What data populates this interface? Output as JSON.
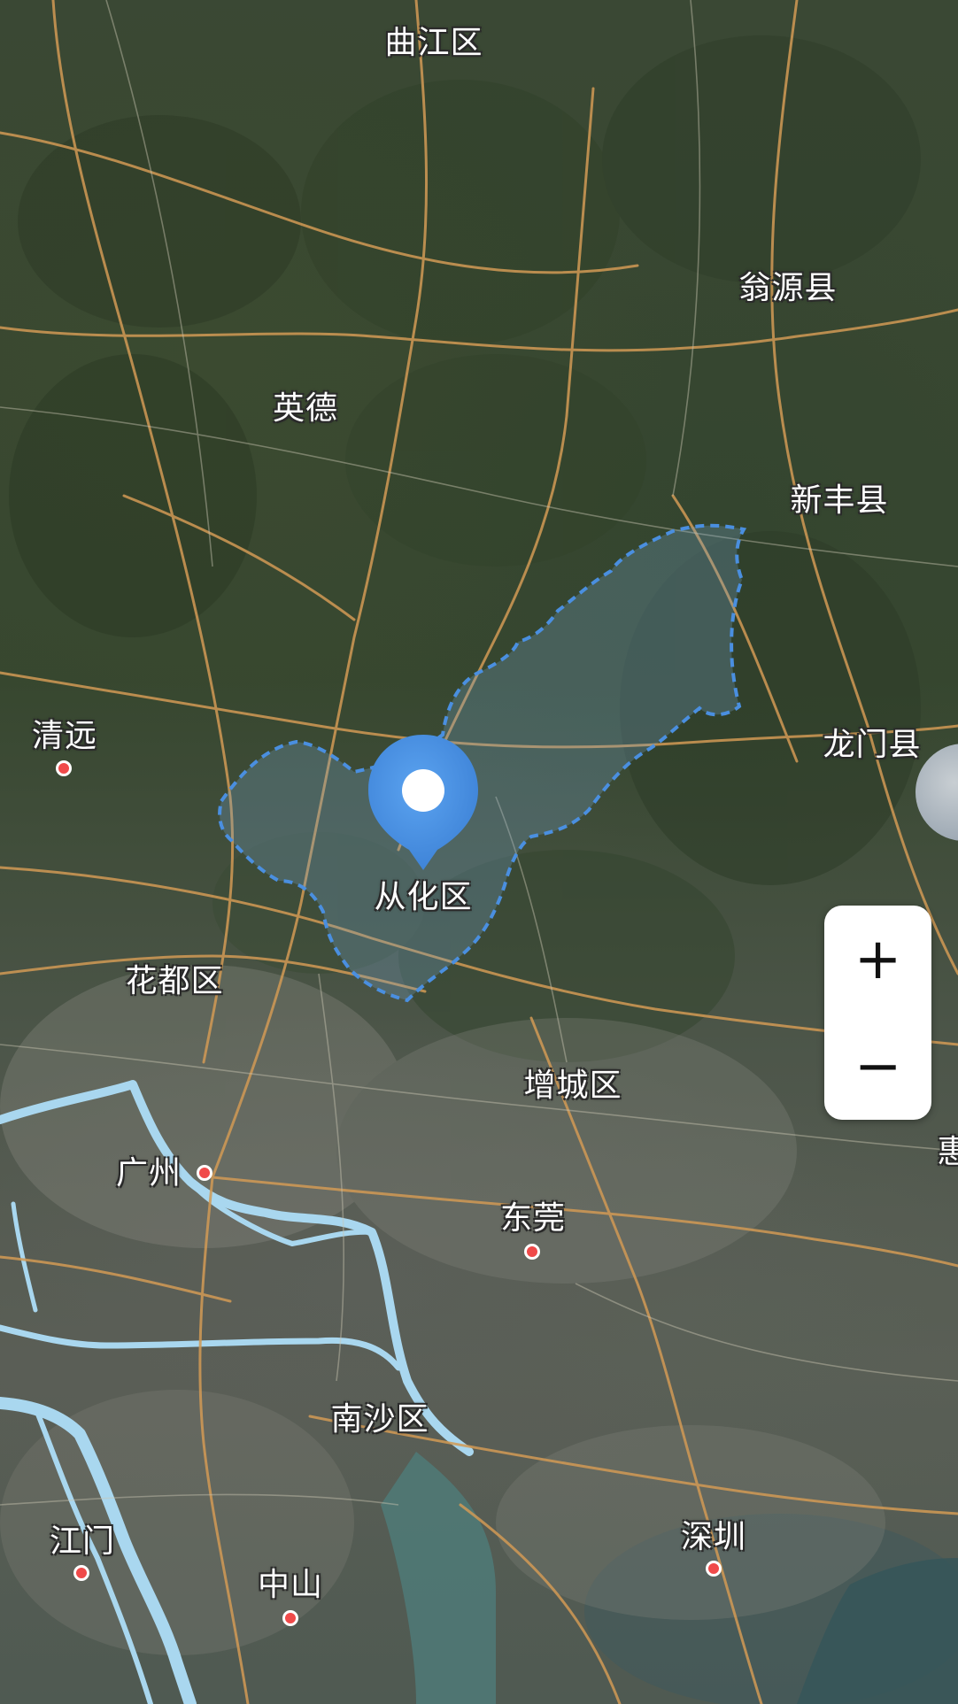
{
  "map": {
    "type": "satellite",
    "selected_region": {
      "name": "从化区",
      "accent_color": "#4a8fe0"
    },
    "places": [
      {
        "name": "曲江区",
        "dot": false
      },
      {
        "name": "翁源县",
        "dot": false
      },
      {
        "name": "英德",
        "dot": false
      },
      {
        "name": "新丰县",
        "dot": false
      },
      {
        "name": "清远",
        "dot": true
      },
      {
        "name": "龙门县",
        "dot": false
      },
      {
        "name": "花都区",
        "dot": false
      },
      {
        "name": "增城区",
        "dot": false
      },
      {
        "name": "广州",
        "dot": true
      },
      {
        "name": "东莞",
        "dot": true
      },
      {
        "name": "南沙区",
        "dot": false
      },
      {
        "name": "江门",
        "dot": true
      },
      {
        "name": "中山",
        "dot": true
      },
      {
        "name": "深圳",
        "dot": true
      },
      {
        "name": "惠",
        "dot": false
      }
    ]
  },
  "controls": {
    "zoom_in_label": "+",
    "zoom_out_label": "−"
  }
}
